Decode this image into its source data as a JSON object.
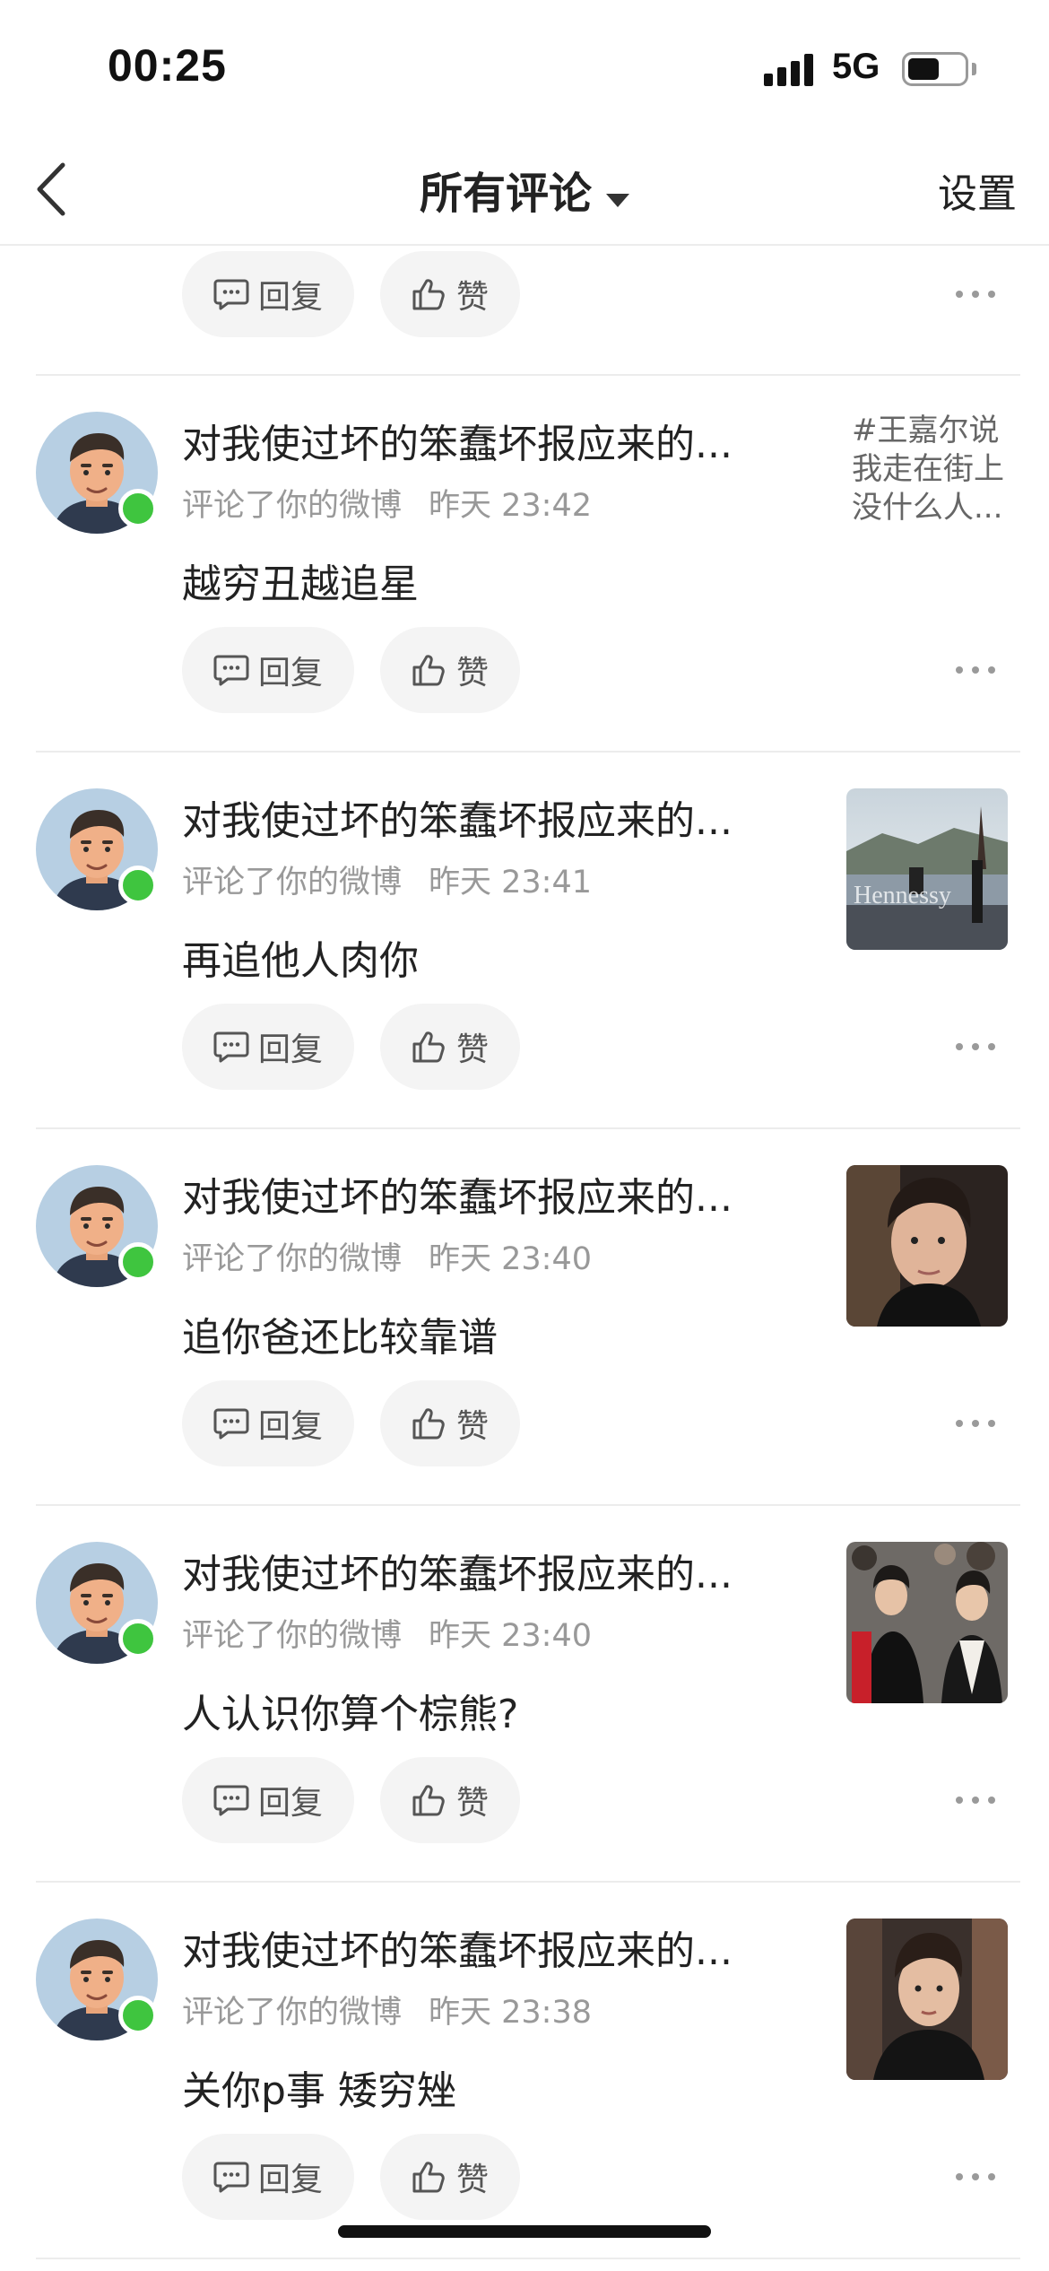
{
  "status_bar": {
    "time": "00:25",
    "network": "5G",
    "battery_level": 0.55
  },
  "nav": {
    "title": "所有评论",
    "settings": "设置"
  },
  "actions": {
    "reply": "回复",
    "like": "赞"
  },
  "comments": [
    {
      "user": "对我使过坏的笨蠢坏报应来的...",
      "action": "评论了你的微博",
      "time": "昨天 23:42",
      "text": "越穷丑越追星",
      "post_preview_text": [
        "#王嘉尔说",
        "我走在街上",
        "没什么人..."
      ]
    },
    {
      "user": "对我使过坏的笨蠢坏报应来的...",
      "action": "评论了你的微博",
      "time": "昨天 23:41",
      "text": "再追他人肉你",
      "post_preview_image": "lake-landscape-photo",
      "post_preview_caption": "Hennessy"
    },
    {
      "user": "对我使过坏的笨蠢坏报应来的...",
      "action": "评论了你的微博",
      "time": "昨天 23:40",
      "text": "追你爸还比较靠谱",
      "post_preview_image": "portrait-photo"
    },
    {
      "user": "对我使过坏的笨蠢坏报应来的...",
      "action": "评论了你的微博",
      "time": "昨天 23:40",
      "text": "人认识你算个棕熊?",
      "post_preview_image": "event-crowd-photo"
    },
    {
      "user": "对我使过坏的笨蠢坏报应来的...",
      "action": "评论了你的微博",
      "time": "昨天 23:38",
      "text": "关你p事 矮穷矬",
      "post_preview_image": "red-carpet-photo"
    }
  ],
  "colors": {
    "online": "#3fc53f",
    "pill_bg": "#f4f4f4",
    "meta_text": "#999999"
  }
}
